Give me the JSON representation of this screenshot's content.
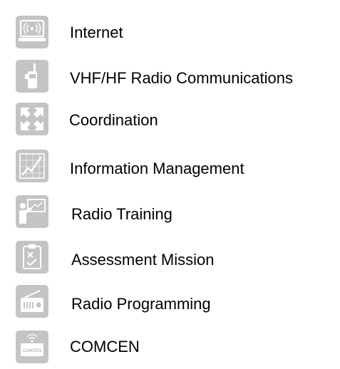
{
  "accent_color": "#c4c4c4",
  "items": [
    {
      "label": "Internet",
      "icon": "laptop-wifi-icon"
    },
    {
      "label": "VHF/HF Radio Communications",
      "icon": "handheld-radio-icon"
    },
    {
      "label": "Coordination",
      "icon": "converging-arrows-icon"
    },
    {
      "label": "Information Management",
      "icon": "chart-trend-icon"
    },
    {
      "label": "Radio Training",
      "icon": "presenter-board-icon"
    },
    {
      "label": "Assessment Mission",
      "icon": "clipboard-checklist-icon"
    },
    {
      "label": "Radio Programming",
      "icon": "radio-set-icon"
    },
    {
      "label": "COMCEN",
      "icon": "comcen-building-icon",
      "icon_text": "COMCEN"
    }
  ]
}
